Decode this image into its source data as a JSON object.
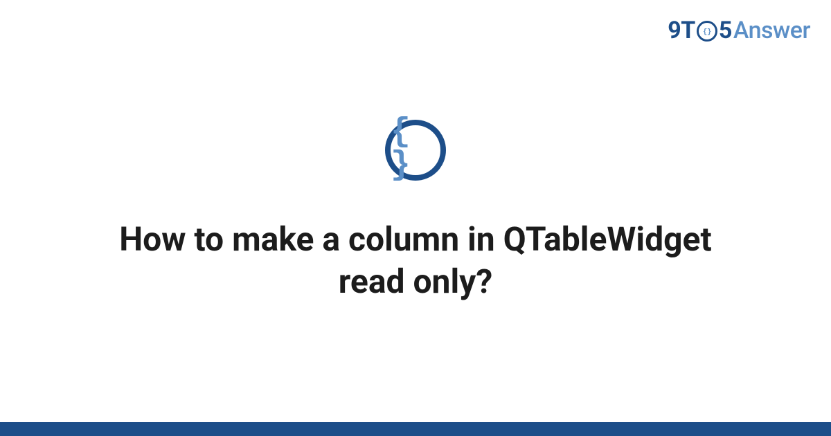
{
  "brand": {
    "part1": "9T",
    "part2": "5",
    "part3": "Answer"
  },
  "badge": {
    "glyph": "{ }"
  },
  "article": {
    "title": "How to make a column in QTableWidget read only?"
  },
  "colors": {
    "primary": "#1d4e89",
    "secondary": "#5b8fc7"
  }
}
